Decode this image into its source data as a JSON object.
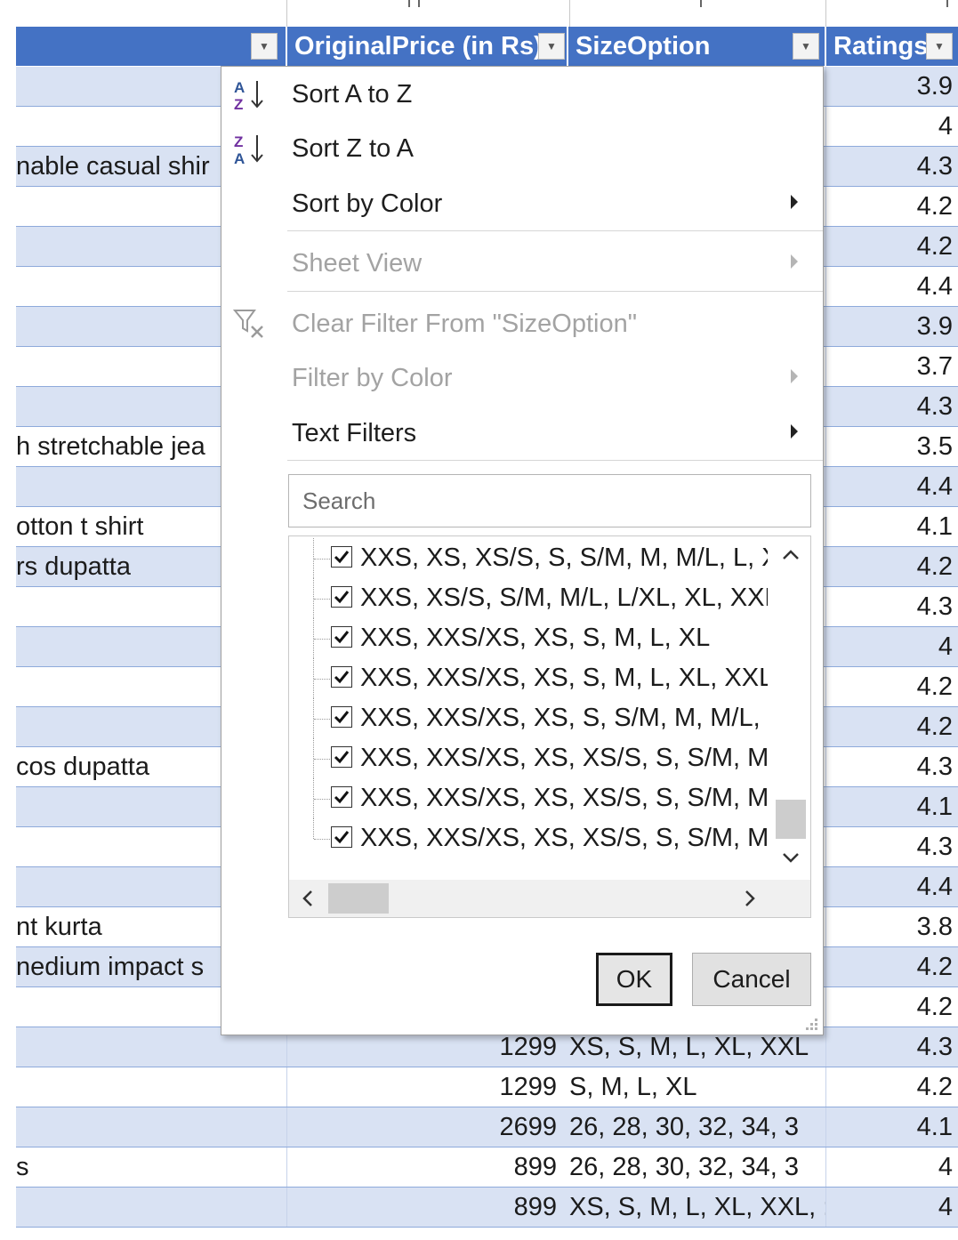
{
  "headers": {
    "name_col": "",
    "price_col": "OriginalPrice (in Rs)",
    "size_col": "SizeOption",
    "rating_col": "Ratings"
  },
  "rows": [
    {
      "name": "",
      "price": "",
      "size": "",
      "rating": "3.9"
    },
    {
      "name": "",
      "price": "",
      "size": "",
      "rating": "4"
    },
    {
      "name": "nable casual shir",
      "price": "",
      "size": "",
      "rating": "4.3"
    },
    {
      "name": "",
      "price": "",
      "size": "",
      "rating": "4.2"
    },
    {
      "name": "",
      "price": "",
      "size": "",
      "rating": "4.2"
    },
    {
      "name": "",
      "price": "",
      "size": "",
      "rating": "4.4"
    },
    {
      "name": "",
      "price": "",
      "size": "",
      "rating": "3.9"
    },
    {
      "name": "",
      "price": "",
      "size": "",
      "rating": "3.7"
    },
    {
      "name": "",
      "price": "",
      "size": "",
      "rating": "4.3"
    },
    {
      "name": "h stretchable jea",
      "price": "",
      "size": "",
      "rating": "3.5"
    },
    {
      "name": "",
      "price": "",
      "size": "",
      "rating": "4.4"
    },
    {
      "name": "otton t shirt",
      "price": "",
      "size": "",
      "rating": "4.1"
    },
    {
      "name": "rs  dupatta",
      "price": "",
      "size": "",
      "rating": "4.2"
    },
    {
      "name": "",
      "price": "",
      "size": "",
      "rating": "4.3"
    },
    {
      "name": "",
      "price": "",
      "size": "",
      "rating": "4"
    },
    {
      "name": "",
      "price": "",
      "size": "",
      "rating": "4.2"
    },
    {
      "name": "",
      "price": "",
      "size": "",
      "rating": "4.2"
    },
    {
      "name": "cos  dupatta",
      "price": "",
      "size": "",
      "rating": "4.3"
    },
    {
      "name": "",
      "price": "",
      "size": "",
      "rating": "4.1"
    },
    {
      "name": "",
      "price": "",
      "size": "",
      "rating": "4.3"
    },
    {
      "name": "",
      "price": "",
      "size": "",
      "rating": "4.4"
    },
    {
      "name": "nt kurta",
      "price": "",
      "size": "",
      "rating": "3.8"
    },
    {
      "name": "nedium impact s",
      "price": "",
      "size": "",
      "rating": "4.2"
    },
    {
      "name": "",
      "price": "",
      "size": "",
      "rating": "4.2"
    },
    {
      "name": "",
      "price": "1299",
      "size": "XS, S, M, L, XL, XXL",
      "rating": "4.3"
    },
    {
      "name": "",
      "price": "1299",
      "size": "S, M, L, XL",
      "rating": "4.2"
    },
    {
      "name": "",
      "price": "2699",
      "size": "26, 28, 30, 32, 34, 3",
      "rating": "4.1"
    },
    {
      "name": "s",
      "price": "899",
      "size": "26, 28, 30, 32, 34, 3",
      "rating": "4"
    },
    {
      "name": "",
      "price": "899",
      "size": "XS, S, M, L, XL, XXL, :",
      "rating": "4"
    }
  ],
  "menu": {
    "sort_az": "Sort A to Z",
    "sort_za": "Sort Z to A",
    "sort_color": "Sort by Color",
    "sheet_view": "Sheet View",
    "clear_filter": "Clear Filter From \"SizeOption\"",
    "filter_color": "Filter by Color",
    "text_filters": "Text Filters"
  },
  "search": {
    "placeholder": "Search"
  },
  "filter_items": [
    {
      "label": "XXS, XS, XS/S, S, S/M, M, M/L, L, XL",
      "checked": true
    },
    {
      "label": "XXS, XS/S, S/M, M/L, L/XL, XL, XXL",
      "checked": true
    },
    {
      "label": "XXS, XXS/XS, XS, S, M, L, XL",
      "checked": true
    },
    {
      "label": "XXS, XXS/XS, XS, S, M, L, XL, XXL",
      "checked": true
    },
    {
      "label": "XXS, XXS/XS, XS, S, S/M, M, M/L, L,",
      "checked": true
    },
    {
      "label": "XXS, XXS/XS, XS, XS/S, S, S/M, M, L",
      "checked": true
    },
    {
      "label": "XXS, XXS/XS, XS, XS/S, S, S/M, M, M",
      "checked": true
    },
    {
      "label": "XXS, XXS/XS, XS, XS/S, S, S/M, M, M",
      "checked": true
    }
  ],
  "buttons": {
    "ok": "OK",
    "cancel": "Cancel"
  },
  "colors": {
    "header_blue": "#4472c4",
    "band_blue": "#d9e2f3",
    "border_blue": "#8eaadb"
  }
}
